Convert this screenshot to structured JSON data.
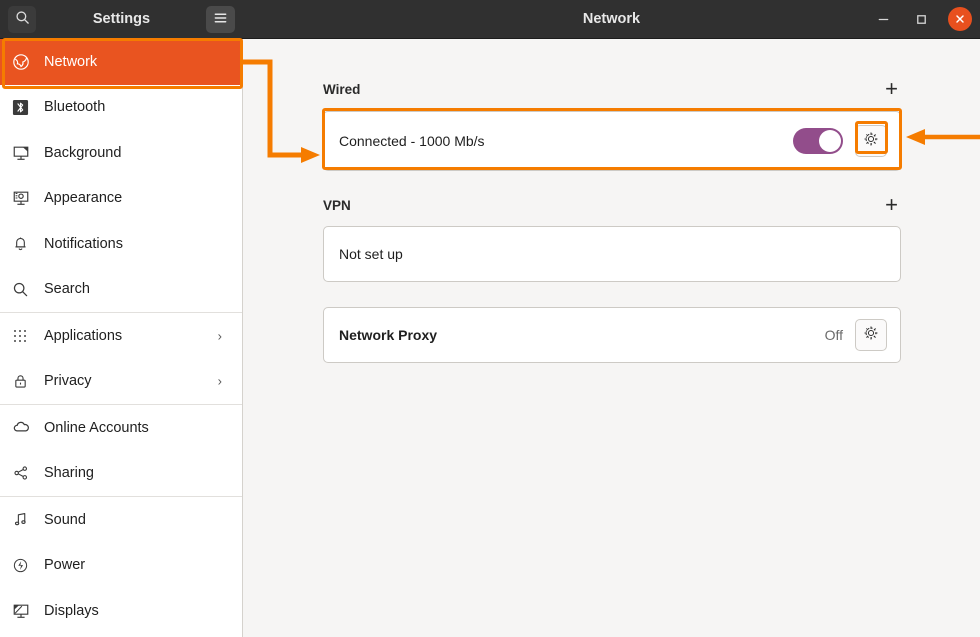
{
  "window": {
    "sidebar_title": "Settings",
    "title": "Network",
    "controls": {
      "minimize": "–",
      "maximize": "□",
      "close": "✕"
    },
    "search_icon": "search-icon",
    "menu_icon": "hamburger-icon"
  },
  "sidebar": {
    "items": [
      {
        "label": "Network",
        "icon": "globe-icon",
        "active": true,
        "chevron": ""
      },
      {
        "label": "Bluetooth",
        "icon": "bluetooth-icon",
        "active": false,
        "chevron": ""
      },
      {
        "label": "Background",
        "icon": "monitor-icon",
        "active": false,
        "chevron": ""
      },
      {
        "label": "Appearance",
        "icon": "appearance-icon",
        "active": false,
        "chevron": ""
      },
      {
        "label": "Notifications",
        "icon": "bell-icon",
        "active": false,
        "chevron": ""
      },
      {
        "label": "Search",
        "icon": "search-icon",
        "active": false,
        "chevron": ""
      },
      {
        "label": "Applications",
        "icon": "grid-dots-icon",
        "active": false,
        "chevron": "›"
      },
      {
        "label": "Privacy",
        "icon": "lock-icon",
        "active": false,
        "chevron": "›"
      },
      {
        "label": "Online Accounts",
        "icon": "cloud-icon",
        "active": false,
        "chevron": ""
      },
      {
        "label": "Sharing",
        "icon": "share-icon",
        "active": false,
        "chevron": ""
      },
      {
        "label": "Sound",
        "icon": "music-note-icon",
        "active": false,
        "chevron": ""
      },
      {
        "label": "Power",
        "icon": "power-icon",
        "active": false,
        "chevron": ""
      },
      {
        "label": "Displays",
        "icon": "displays-icon",
        "active": false,
        "chevron": ""
      }
    ],
    "separators_after": [
      5,
      7,
      9
    ]
  },
  "main": {
    "wired": {
      "heading": "Wired",
      "add_label": "+",
      "status": "Connected - 1000 Mb/s",
      "toggle_on": true,
      "settings_icon": "gear-icon"
    },
    "vpn": {
      "heading": "VPN",
      "add_label": "+",
      "status": "Not set up"
    },
    "proxy": {
      "label": "Network Proxy",
      "value": "Off",
      "settings_icon": "gear-icon"
    }
  },
  "annotations": {
    "accent": "#f57c00",
    "highlight_sidebar_network": true,
    "highlight_wired_row": true,
    "highlight_wired_gear": true
  },
  "colors": {
    "ubuntu_orange": "#e95420",
    "annotation_orange": "#f57c00",
    "toggle_purple": "#924d8b",
    "titlebar": "#303030",
    "content_bg": "#f6f5f4"
  }
}
